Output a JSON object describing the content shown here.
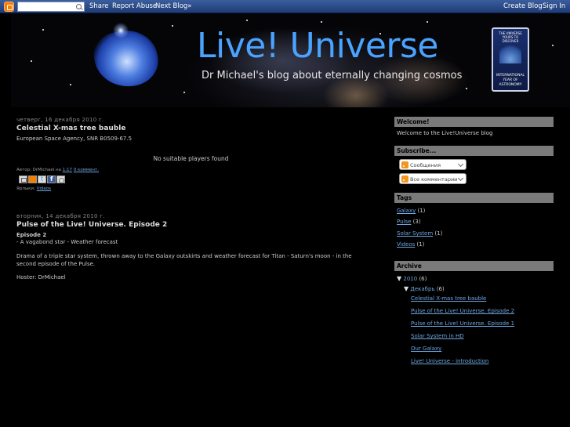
{
  "navbar": {
    "search_placeholder": "",
    "share": "Share",
    "report_abuse": "Report Abuse",
    "next_blog": "Next Blog»",
    "create_blog": "Create Blog",
    "sign_in": "Sign In"
  },
  "header": {
    "title": "Live! Universe",
    "description": "Dr Michael's blog about eternally changing cosmos",
    "book_top": "THE UNIVERSE YOURS TO DISCOVER",
    "book_bottom": "INTERNATIONAL YEAR OF ASTRONOMY"
  },
  "posts": [
    {
      "date": "четверг, 16 декабря 2010 г.",
      "title": "Celestial X-mas tree bauble",
      "body": "European Space Agency, SNR B0509-67.5",
      "player": "No suitable players found",
      "author_prefix": "Автор: DrMichael на",
      "time": "1:17",
      "comments": "0 коммент.",
      "labels_prefix": "Ярлыки:",
      "label": "Videos"
    },
    {
      "date": "вторник, 14 декабря 2010 г.",
      "title": "Pulse of the Live! Universe. Episode 2",
      "subtitle": "Episode 2",
      "line1": "- A vagabond star - Weather forecast",
      "description": "Drama of a triple star system, thrown away to the Galaxy outskirts and weather forecast for Titan - Saturn's moon - in the second episode of the Pulse.",
      "host": "Hoster: DrMichael"
    }
  ],
  "sidebar": {
    "welcome_title": "Welcome!",
    "welcome_text": "Welcome to the Live!Universe blog",
    "subscribe_title": "Subscribe...",
    "subscribe_posts": "Сообщения",
    "subscribe_comments": "Все комментарии",
    "tags_title": "Tags",
    "tags": [
      {
        "name": "Galaxy",
        "count": "(1)"
      },
      {
        "name": "Pulse",
        "count": "(3)"
      },
      {
        "name": "Solar System",
        "count": "(1)"
      },
      {
        "name": "Videos",
        "count": "(1)"
      }
    ],
    "archive_title": "Archive",
    "archive_year": "2010",
    "archive_year_count": "(6)",
    "archive_month": "Декабрь",
    "archive_month_count": "(6)",
    "archive_posts": [
      "Celestial X-mas tree bauble",
      "Pulse of the Live! Universe. Episode 2",
      "Pulse of the Live! Universe. Episode 1",
      "Solar System in HD",
      "Our Galaxy",
      "Live! Universe - introduction"
    ]
  },
  "colors": {
    "background": "#000000",
    "navbar": "#2b4a8a",
    "title_blue": "#4aa3ff",
    "link": "#6fa6e0",
    "widget_header": "#7a7a7a"
  }
}
